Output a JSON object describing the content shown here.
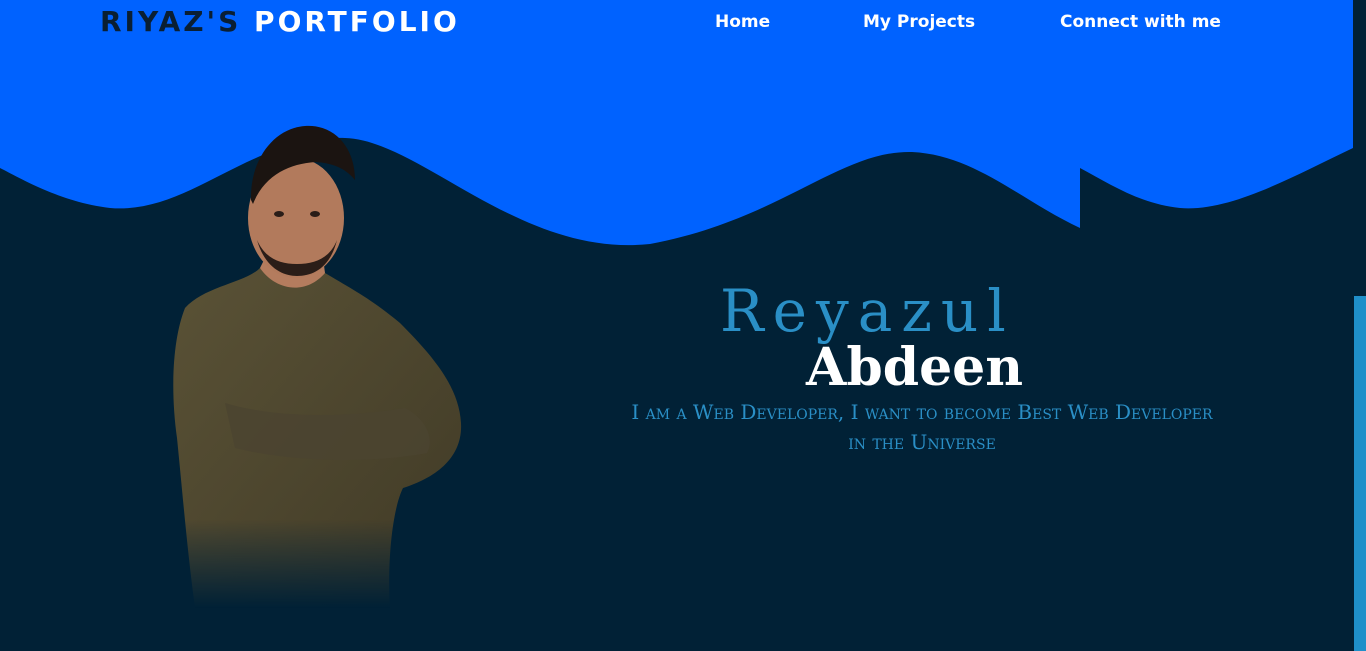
{
  "header": {
    "logo_part1": "RIYAZ'S",
    "logo_part2": "PORTFOLIO",
    "nav": {
      "home": "Home",
      "projects": "My Projects",
      "connect": "Connect with me"
    }
  },
  "hero": {
    "first_name": "Reyazul",
    "last_name": "Abdeen",
    "tagline": "I am a Web Developer, I want to become Best Web Developer in the Universe"
  },
  "colors": {
    "header_blue": "#0062ff",
    "background_navy": "#012136",
    "accent": "#2a8fc6",
    "white": "#ffffff",
    "scrollbar_thumb": "#1f8fc9"
  }
}
